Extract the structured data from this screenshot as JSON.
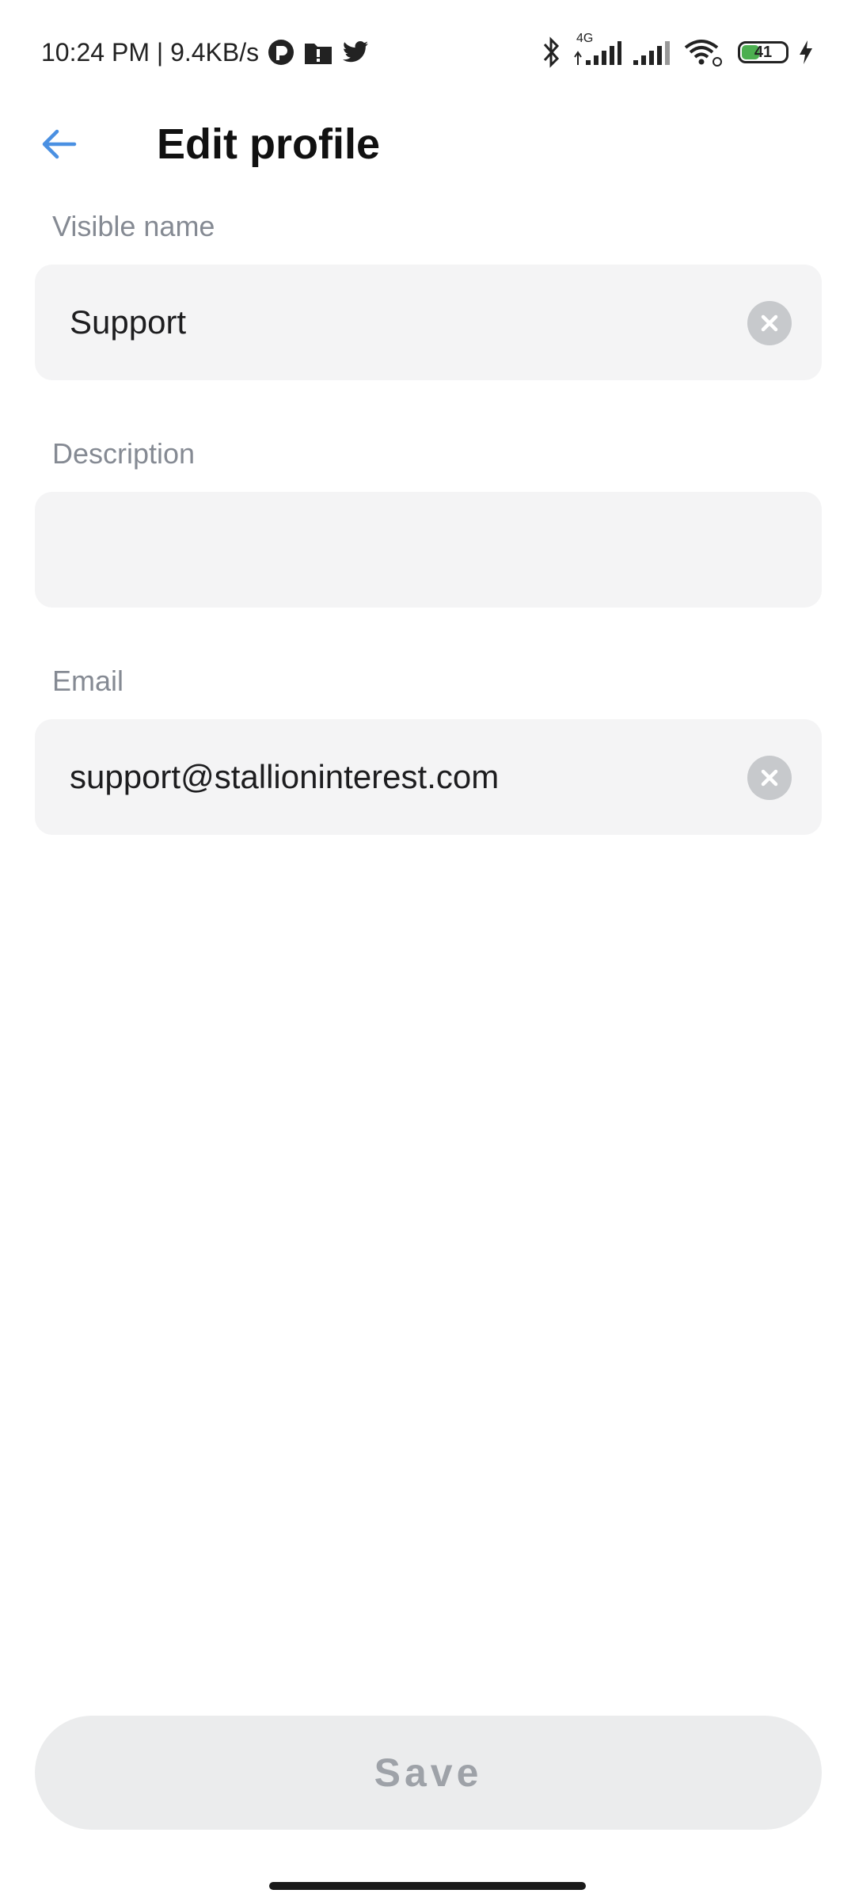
{
  "status_bar": {
    "time_speed": "10:24 PM | 9.4KB/s",
    "left_icons": [
      "app-notification-icon",
      "folder-alert-icon",
      "twitter-icon"
    ],
    "right_icons": [
      "bluetooth-icon",
      "signal-4g-icon",
      "signal-icon",
      "wifi-icon",
      "battery-icon",
      "charging-icon"
    ],
    "network_type": "4G",
    "battery_level": "41",
    "battery_fraction": 0.41,
    "battery_color": "#4caf50"
  },
  "header": {
    "back_icon": "arrow-left-icon",
    "back_color": "#4a90e2",
    "title": "Edit profile"
  },
  "form": {
    "visible_name": {
      "label": "Visible name",
      "value": "Support",
      "clear_icon": "clear-circle-icon"
    },
    "description": {
      "label": "Description",
      "value": ""
    },
    "email": {
      "label": "Email",
      "value": "support@stallioninterest.com",
      "clear_icon": "clear-circle-icon"
    }
  },
  "actions": {
    "save_label": "Save",
    "save_enabled": false
  }
}
